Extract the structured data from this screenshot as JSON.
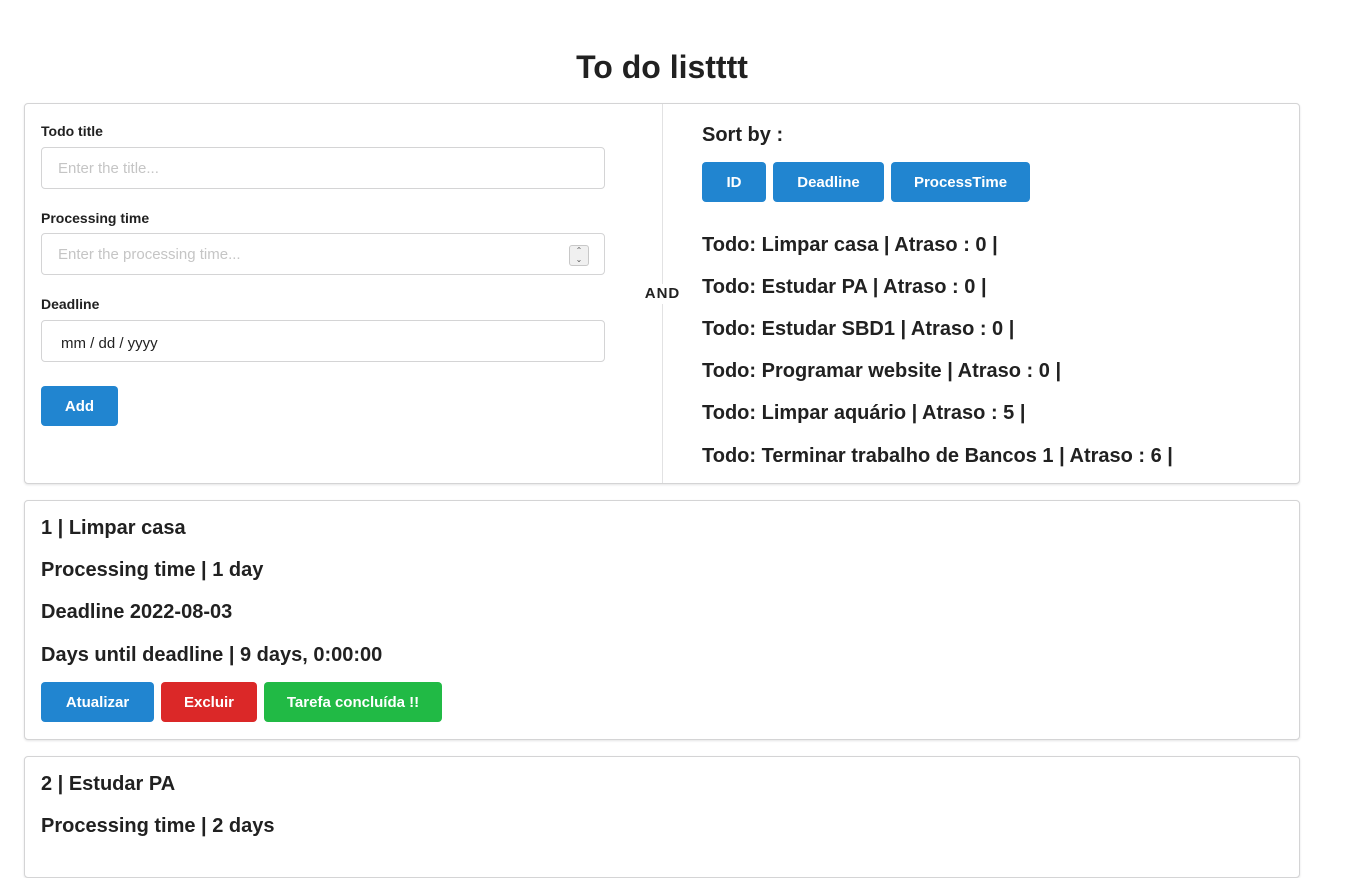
{
  "page": {
    "title": "To do listttt"
  },
  "form": {
    "title_label": "Todo title",
    "title_placeholder": "Enter the title...",
    "processing_label": "Processing time",
    "processing_placeholder": "Enter the processing time...",
    "deadline_label": "Deadline",
    "deadline_value": "mm / dd / yyyy",
    "add_label": "Add",
    "spinner_up": "⌃",
    "spinner_down": "⌄"
  },
  "divider": {
    "text": "AND"
  },
  "sort": {
    "title": "Sort by :",
    "buttons": [
      {
        "label": "ID"
      },
      {
        "label": "Deadline"
      },
      {
        "label": "ProcessTime"
      }
    ]
  },
  "ordered_todos": [
    "Todo: Limpar casa | Atraso : 0 |",
    "Todo: Estudar PA | Atraso : 0 |",
    "Todo: Estudar SBD1 | Atraso : 0 |",
    "Todo: Programar website | Atraso : 0 |",
    "Todo: Limpar aquário | Atraso : 5 |",
    "Todo: Terminar trabalho de Bancos 1 | Atraso : 6 |"
  ],
  "cards": [
    {
      "header": "1 | Limpar casa",
      "processing": "Processing time | 1 day",
      "deadline": "Deadline 2022-08-03",
      "days_until": "Days until deadline | 9 days, 0:00:00",
      "update_label": "Atualizar",
      "delete_label": "Excluir",
      "done_label": "Tarefa concluída !!"
    },
    {
      "header": "2 | Estudar PA",
      "processing": "Processing time | 2 days"
    }
  ],
  "colors": {
    "primary": "#2185d0",
    "danger": "#db2828",
    "success": "#21ba45"
  }
}
